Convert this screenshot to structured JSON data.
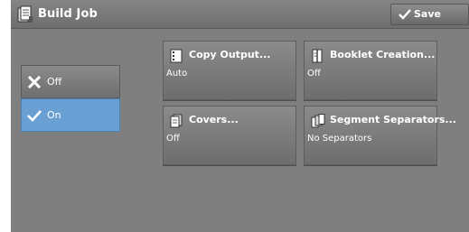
{
  "header": {
    "title": "Build Job",
    "title_icon": "build-job-icon",
    "save_label": "Save"
  },
  "toggles": {
    "off_label": "Off",
    "on_label": "On",
    "selected": "On"
  },
  "features": [
    {
      "name": "Copy Output...",
      "value": "Auto",
      "icon": "copy-output-icon"
    },
    {
      "name": "Booklet Creation...",
      "value": "Off",
      "icon": "booklet-icon"
    },
    {
      "name": "Covers...",
      "value": "Off",
      "icon": "covers-icon"
    },
    {
      "name": "Segment Separators...",
      "value": "No Separators",
      "icon": "segment-separators-icon"
    }
  ],
  "colors": {
    "panel": "#7f7f7f",
    "selected": "#6a9fd3"
  }
}
